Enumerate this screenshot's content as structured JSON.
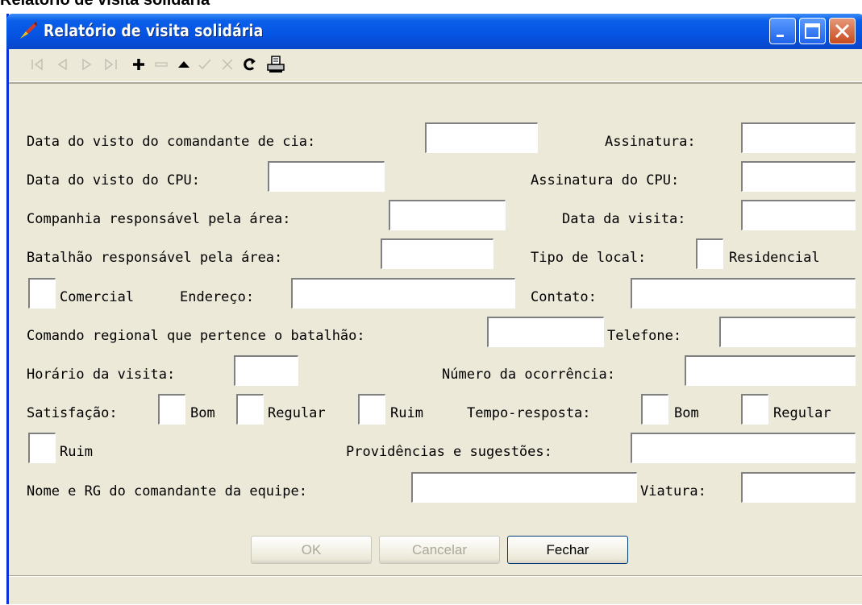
{
  "page": {
    "heading": "Relatório de visita solidária"
  },
  "window": {
    "title": "Relatório de visita solidária",
    "controls": {
      "minimize_icon": "minimize-icon",
      "maximize_icon": "maximize-icon",
      "close_icon": "close-icon"
    }
  },
  "toolbar": {
    "items": [
      "first-record-icon",
      "prev-record-icon",
      "next-record-icon",
      "last-record-icon",
      "insert-record-icon",
      "delete-record-icon",
      "edit-record-icon",
      "post-edit-icon",
      "cancel-edit-icon",
      "refresh-icon",
      "print-icon"
    ],
    "disabled": [
      "first-record-icon",
      "prev-record-icon",
      "next-record-icon",
      "last-record-icon",
      "delete-record-icon",
      "post-edit-icon",
      "cancel-edit-icon"
    ]
  },
  "form": {
    "visto_comandante": {
      "label": "Data do visto do comandante de cia:",
      "value": ""
    },
    "assinatura": {
      "label": "Assinatura:",
      "value": ""
    },
    "visto_cpu": {
      "label": "Data do visto do CPU:",
      "value": ""
    },
    "assinatura_cpu": {
      "label": "Assinatura do CPU:",
      "value": ""
    },
    "companhia": {
      "label": "Companhia responsável pela área:",
      "value": ""
    },
    "data_visita": {
      "label": "Data da visita:",
      "value": ""
    },
    "batalhao": {
      "label": "Batalhão responsável pela área:",
      "value": ""
    },
    "tipo_local": {
      "label": "Tipo de local:",
      "residencial": "Residencial",
      "comercial": "Comercial"
    },
    "endereco": {
      "label": "Endereço:",
      "value": ""
    },
    "contato": {
      "label": "Contato:",
      "value": ""
    },
    "comando_regional": {
      "label": "Comando regional que pertence o batalhão:",
      "value": ""
    },
    "telefone": {
      "label": "Telefone:",
      "value": ""
    },
    "horario": {
      "label": "Horário da visita:",
      "value": ""
    },
    "ocorrencia": {
      "label": "Número da ocorrência:",
      "value": ""
    },
    "satisfacao": {
      "label": "Satisfação:",
      "bom": "Bom",
      "regular": "Regular",
      "ruim": "Ruim"
    },
    "tempo_resposta": {
      "label": "Tempo-resposta:",
      "bom": "Bom",
      "regular": "Regular",
      "ruim": "Ruim"
    },
    "providencias": {
      "label": "Providências e sugestões:",
      "value": ""
    },
    "nome_rg": {
      "label": "Nome e RG do comandante da equipe:",
      "value": ""
    },
    "viatura": {
      "label": "Viatura:",
      "value": ""
    }
  },
  "buttons": {
    "ok": "OK",
    "cancelar": "Cancelar",
    "fechar": "Fechar"
  },
  "colors": {
    "titlebar": "#0553e3",
    "window_bg": "#ece9d8",
    "close_button": "#c84b1e"
  }
}
